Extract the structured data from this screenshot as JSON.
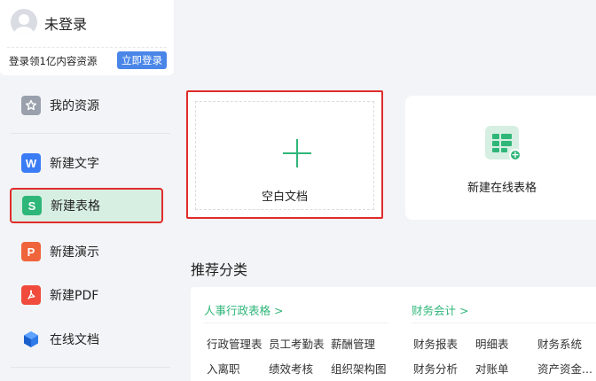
{
  "user": {
    "name": "未登录",
    "promo": "登录领1亿内容资源",
    "login_label": "立即登录"
  },
  "sidebar": {
    "items": [
      {
        "label": "我的资源",
        "icon": "star-icon",
        "color": "#9aa1ad"
      },
      {
        "label": "新建文字",
        "icon": "writer-icon",
        "color": "#3a7cf5",
        "glyph": "W"
      },
      {
        "label": "新建表格",
        "icon": "spreadsheet-icon",
        "color": "#2fb679",
        "glyph": "S"
      },
      {
        "label": "新建演示",
        "icon": "presentation-icon",
        "color": "#f0643c",
        "glyph": "P"
      },
      {
        "label": "新建PDF",
        "icon": "pdf-icon",
        "color": "#f04b3c"
      },
      {
        "label": "在线文档",
        "icon": "cloud-doc-icon",
        "color": "#2f7be8"
      }
    ],
    "active_index": 2
  },
  "main": {
    "blank_doc_label": "空白文档",
    "online_sheet_label": "新建在线表格",
    "section_title": "推荐分类",
    "categories": [
      {
        "title": "人事行政表格 >",
        "rows": [
          [
            "行政管理表",
            "员工考勤表",
            "薪酬管理"
          ],
          [
            "入离职",
            "绩效考核",
            "组织架构图"
          ]
        ]
      },
      {
        "title": "财务会计 >",
        "rows": [
          [
            "财务报表",
            "明细表",
            "财务系统"
          ],
          [
            "财务分析",
            "对账单",
            "资产资金..."
          ]
        ]
      }
    ]
  },
  "colors": {
    "accent_green": "#2fb679",
    "highlight_red": "#e02b2b",
    "login_blue": "#4a86e8"
  }
}
